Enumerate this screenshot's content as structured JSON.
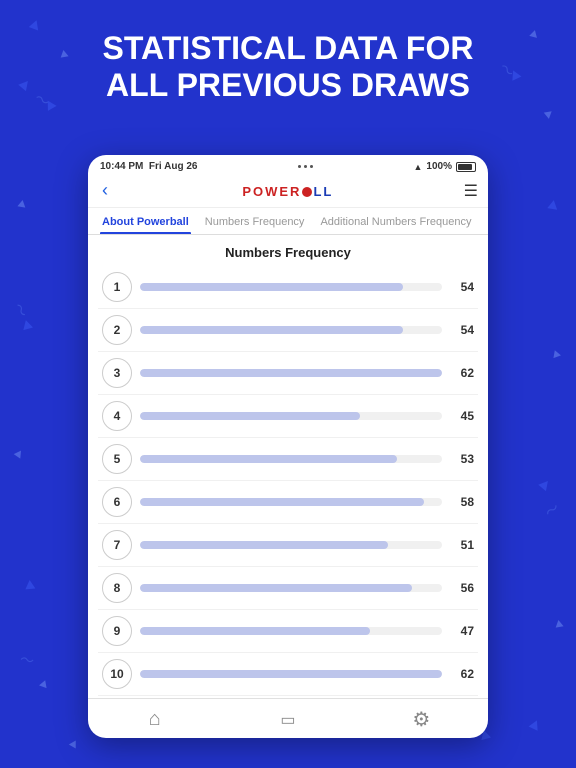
{
  "hero": {
    "line1": "STATISTICAL DATA FOR",
    "line2": "ALL PREVIOUS DRAWS"
  },
  "status_bar": {
    "time": "10:44 PM",
    "date": "Fri Aug 26",
    "signal": "100%"
  },
  "app": {
    "logo_text": "POWERBALL",
    "back_label": "‹"
  },
  "tabs": [
    {
      "id": "about",
      "label": "About Powerball",
      "active": true
    },
    {
      "id": "freq",
      "label": "Numbers Frequency",
      "active": false
    },
    {
      "id": "addfreq",
      "label": "Additional Numbers Frequency",
      "active": false
    }
  ],
  "content": {
    "section_title": "Numbers Frequency",
    "rows": [
      {
        "number": "1",
        "count": "54",
        "pct": 82
      },
      {
        "number": "2",
        "count": "54",
        "pct": 82
      },
      {
        "number": "3",
        "count": "62",
        "pct": 94
      },
      {
        "number": "4",
        "count": "45",
        "pct": 68
      },
      {
        "number": "5",
        "count": "53",
        "pct": 80
      },
      {
        "number": "6",
        "count": "58",
        "pct": 88
      },
      {
        "number": "7",
        "count": "51",
        "pct": 77
      },
      {
        "number": "8",
        "count": "56",
        "pct": 85
      },
      {
        "number": "9",
        "count": "47",
        "pct": 71
      },
      {
        "number": "10",
        "count": "62",
        "pct": 94
      }
    ]
  },
  "bottom_nav": [
    {
      "id": "home",
      "icon": "⌂",
      "label": "Home"
    },
    {
      "id": "tv",
      "icon": "▭",
      "label": "TV"
    },
    {
      "id": "settings",
      "icon": "⚙",
      "label": "Settings"
    }
  ]
}
